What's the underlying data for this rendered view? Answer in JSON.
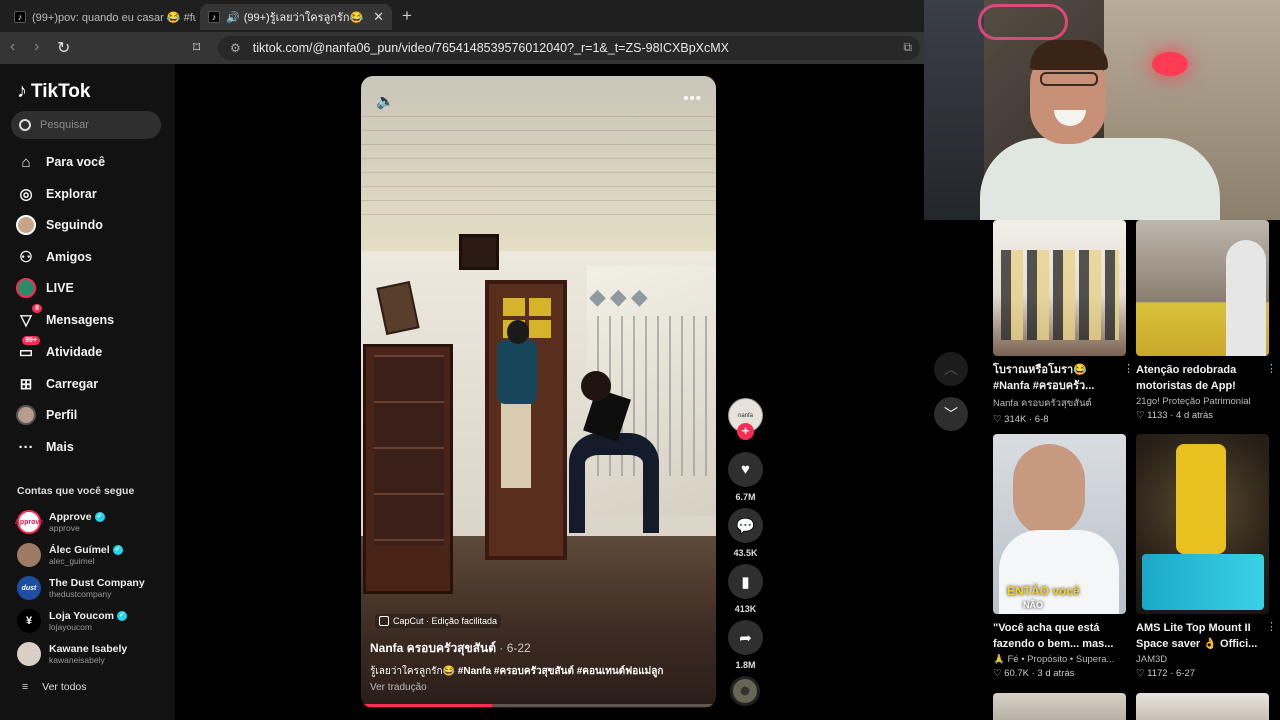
{
  "browser": {
    "tabs": [
      {
        "title": "(99+)pov: quando eu casar 😂 #funnyvideo"
      },
      {
        "title": "(99+)รู้เลยว่าใครลูกรัก😂 #Nanfa #ครอ"
      }
    ],
    "new_tab": "+",
    "url": "tiktok.com/@nanfa06_pun/video/7654148539576012040?_r=1&_t=ZS-98ICXBpXcMX"
  },
  "sidebar": {
    "logo": "TikTok",
    "search_placeholder": "Pesquisar",
    "nav": [
      {
        "label": "Para você",
        "icon": "home-icon"
      },
      {
        "label": "Explorar",
        "icon": "compass-icon"
      },
      {
        "label": "Seguindo",
        "icon": "following-avatar-icon"
      },
      {
        "label": "Amigos",
        "icon": "friends-icon"
      },
      {
        "label": "LIVE",
        "icon": "live-icon"
      },
      {
        "label": "Mensagens",
        "icon": "messages-icon",
        "badge": "8"
      },
      {
        "label": "Atividade",
        "icon": "activity-icon",
        "badge": "99+"
      },
      {
        "label": "Carregar",
        "icon": "upload-icon"
      },
      {
        "label": "Perfil",
        "icon": "profile-icon"
      },
      {
        "label": "Mais",
        "icon": "more-dots-icon"
      }
    ],
    "following_title": "Contas que você segue",
    "following": [
      {
        "name": "Approve",
        "handle": "approve",
        "verified": true
      },
      {
        "name": "Álec Guímel",
        "handle": "alec_guimel",
        "verified": true
      },
      {
        "name": "The Dust Company",
        "handle": "thedustcompany",
        "verified": false
      },
      {
        "name": "Loja Youcom",
        "handle": "lojayoucom",
        "verified": true
      },
      {
        "name": "Kawane Isabely",
        "handle": "kawaneisabely",
        "verified": false
      }
    ],
    "see_all": "Ver todos"
  },
  "video": {
    "capcut": "CapCut · Edição facilitada",
    "author": "Nanfa ครอบครัวสุขสันต์",
    "date": " · 6-22",
    "caption_text": "รู้เลยว่าใครลูกรัก😂 ",
    "caption_tags": "#Nanfa #ครอบครัวสุขสันต์ #คอนเทนต์ฟอแม่ลูก",
    "translate": "Ver tradução",
    "progress": 0.37
  },
  "actions": {
    "likes": "6.7M",
    "comments": "43.5K",
    "saves": "413K",
    "shares": "1.8M"
  },
  "recommended": [
    {
      "title": "โบราณหรือโมรา😂 #Nanfa #ครอบครัว...",
      "author": "Nanfa ครอบครัวสุขสันต์",
      "stats": "314K · 6-8"
    },
    {
      "title": "Atenção redobrada motoristas de App!",
      "author": "21go! Proteção Patrimonial",
      "stats": "1133 · 4 d atrás"
    },
    {
      "title": "\"Você acha que está fazendo o bem... mas...",
      "author": "🙏 Fé • Propósito • Supera...",
      "stats": "60.7K · 3 d atrás",
      "overlay1": "ENTÃO você",
      "overlay2": "NÃO"
    },
    {
      "title": "AMS Lite Top Mount II Space saver 👌 Offici...",
      "author": "JAM3D",
      "stats": "1172 · 6-27"
    }
  ]
}
